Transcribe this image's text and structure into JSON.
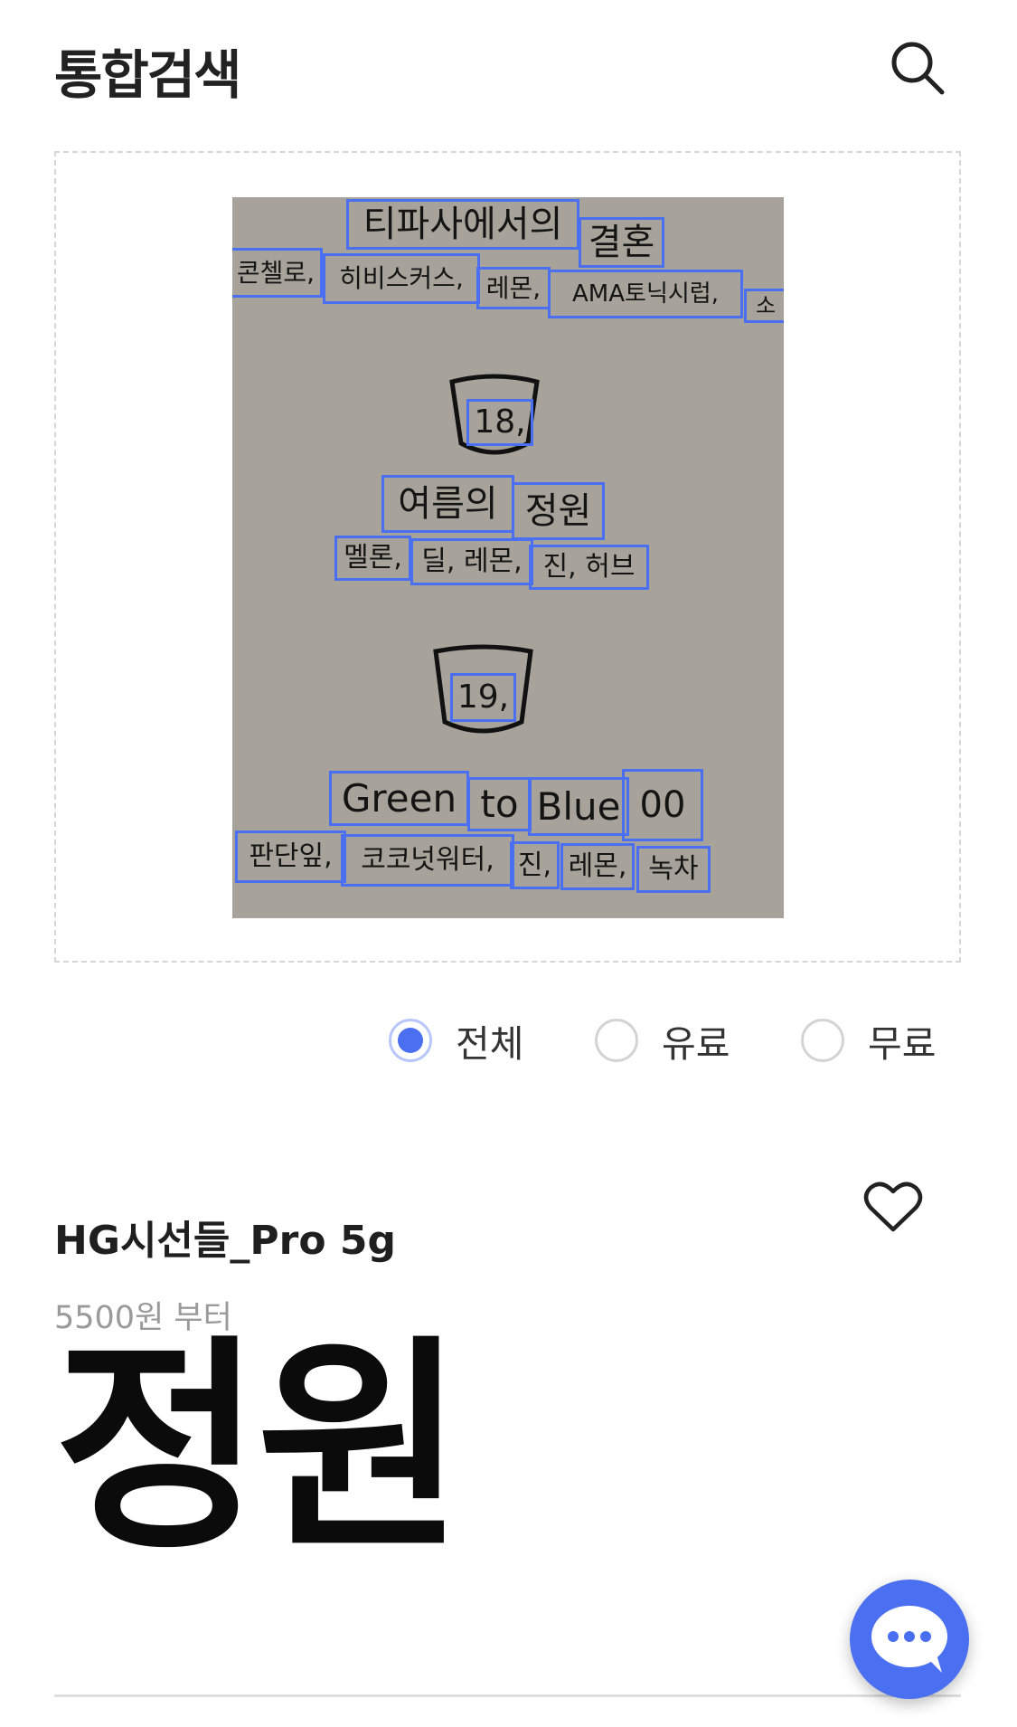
{
  "header": {
    "title": "통합검색"
  },
  "photo": {
    "words": [
      "티파사에서의",
      "결혼",
      "콘첼로,",
      "히비스커스,",
      "레몬,",
      "AMA토닉시럽,",
      "소",
      "18,",
      "여름의",
      "정원",
      "멜론,",
      "딜, 레몬,",
      "진, 허브",
      "19,",
      "Green",
      "to",
      "Blue",
      "00",
      "판단잎,",
      "코코넛워터,",
      "진,",
      "레몬,",
      "녹차"
    ]
  },
  "filters": {
    "options": [
      "전체",
      "유료",
      "무료"
    ],
    "selected": "전체"
  },
  "product": {
    "title": "HG시선들_Pro 5g",
    "price": "5500원 부터",
    "preview_text": "정원"
  },
  "colors": {
    "accent": "#4a6ff0",
    "muted_text": "#9a9a9a",
    "dash_border": "#d6d6d6"
  },
  "icons": {
    "search": "search-icon",
    "favorite": "heart-icon",
    "chat": "chat-bubble-icon"
  }
}
